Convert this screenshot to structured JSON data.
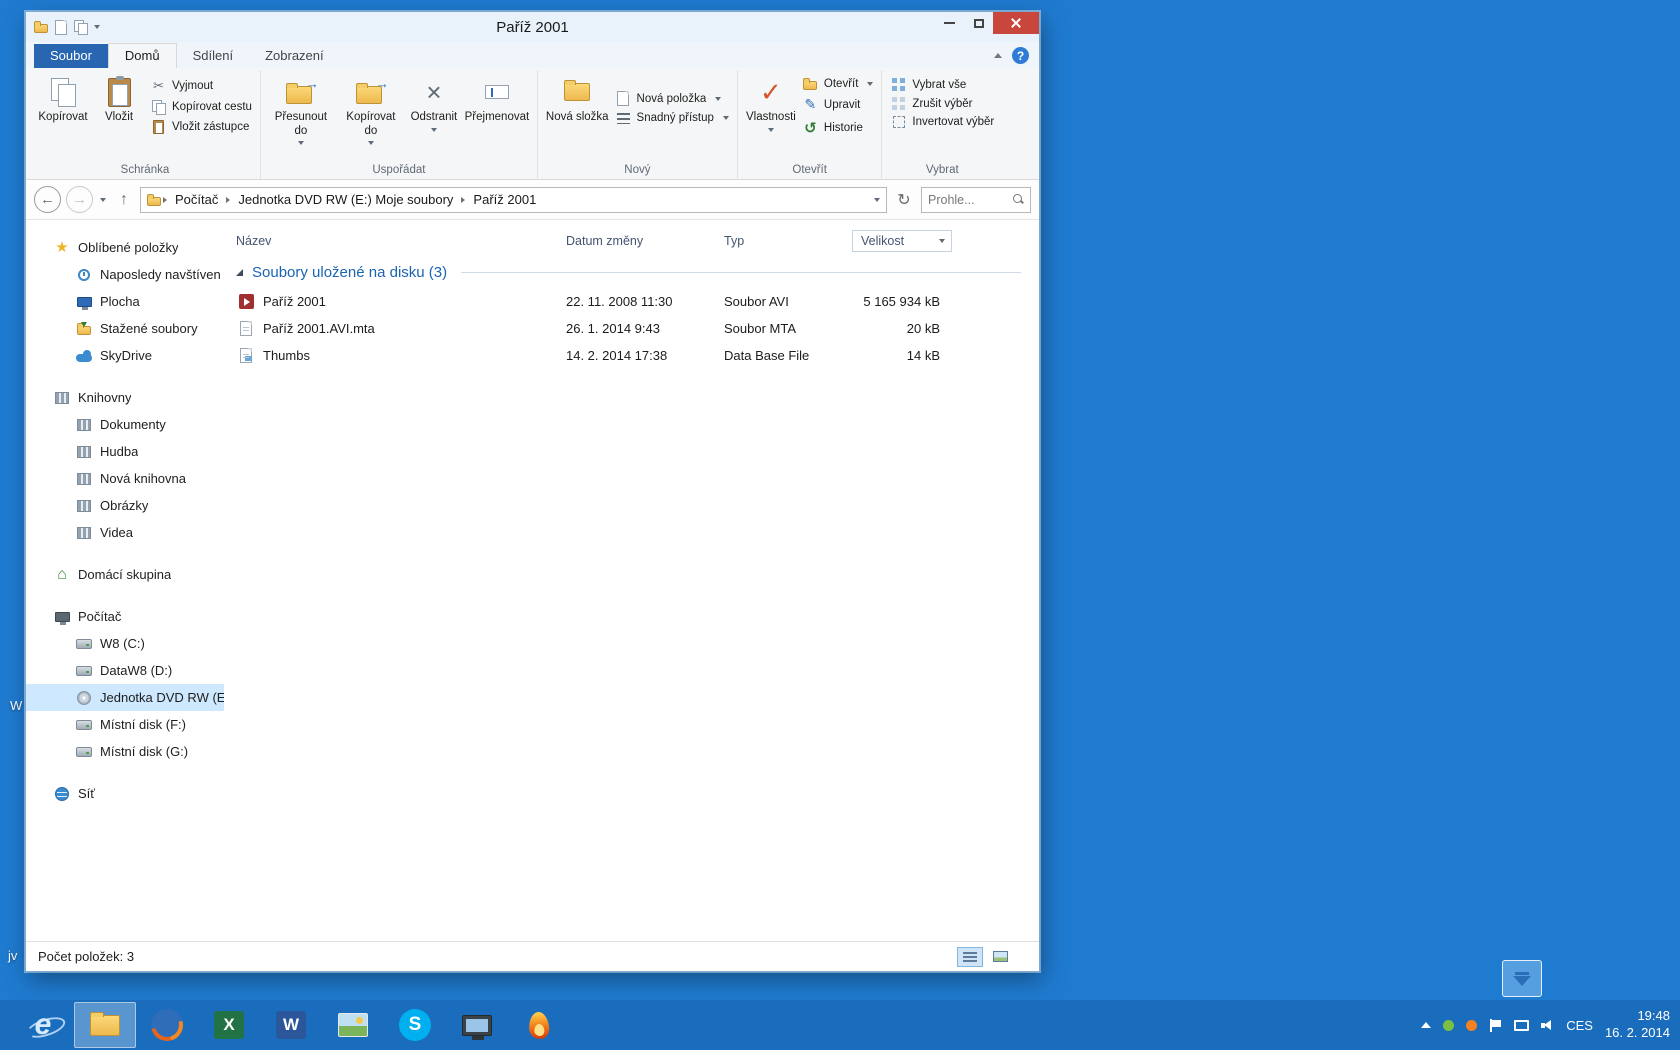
{
  "colors": {
    "desktop": "#1f7bd0",
    "taskbar": "#1a6cbd",
    "window_chrome": "#e9f2fb",
    "close_red": "#c8463c",
    "file_tab_blue": "#2866b2",
    "selection_blue": "#cde8ff",
    "group_header_blue": "#1a64b0"
  },
  "icons": {
    "help": "?",
    "star": "★",
    "back": "←",
    "forward": "→",
    "up": "↑",
    "refresh": "↻",
    "scissors": "✂",
    "delete": "×",
    "check": "✓",
    "pencil": "✎",
    "history": "↺",
    "house": "⌂",
    "arrow_small": "→",
    "ie_letter": "e",
    "excel_letter": "X",
    "word_letter": "W",
    "skype_letter": "S"
  },
  "desktop": {
    "fragments": [
      {
        "text": "W"
      },
      {
        "text": "jv"
      }
    ]
  },
  "window": {
    "title": "Paříž 2001"
  },
  "ribbon": {
    "tabs": [
      {
        "label": "Soubor"
      },
      {
        "label": "Domů"
      },
      {
        "label": "Sdílení"
      },
      {
        "label": "Zobrazení"
      }
    ],
    "groups": [
      {
        "label": "Schránka",
        "big": [
          {
            "label": "Kopírovat"
          },
          {
            "label": "Vložit"
          }
        ],
        "small": [
          {
            "label": "Vyjmout"
          },
          {
            "label": "Kopírovat cestu"
          },
          {
            "label": "Vložit zástupce"
          }
        ]
      },
      {
        "label": "Uspořádat",
        "big": [
          {
            "label": "Přesunout do"
          },
          {
            "label": "Kopírovat do"
          },
          {
            "label": "Odstranit"
          },
          {
            "label": "Přejmenovat"
          }
        ]
      },
      {
        "label": "Nový",
        "big": [
          {
            "label": "Nová složka"
          }
        ],
        "small": [
          {
            "label": "Nová položka"
          },
          {
            "label": "Snadný přístup"
          }
        ]
      },
      {
        "label": "Otevřít",
        "big": [
          {
            "label": "Vlastnosti"
          }
        ],
        "small": [
          {
            "label": "Otevřít"
          },
          {
            "label": "Upravit"
          },
          {
            "label": "Historie"
          }
        ]
      },
      {
        "label": "Vybrat",
        "small": [
          {
            "label": "Vybrat vše"
          },
          {
            "label": "Zrušit výběr"
          },
          {
            "label": "Invertovat výběr"
          }
        ]
      }
    ]
  },
  "address": {
    "crumbs": [
      {
        "label": "Počítač"
      },
      {
        "label": "Jednotka DVD RW (E:) Moje soubory"
      },
      {
        "label": "Paříž 2001"
      }
    ],
    "search_value": "Prohle..."
  },
  "sidebar": {
    "sections": [
      {
        "label": "Oblíbené položky",
        "items": [
          {
            "label": "Naposledy navštíven"
          },
          {
            "label": "Plocha"
          },
          {
            "label": "Stažené soubory"
          },
          {
            "label": "SkyDrive"
          }
        ]
      },
      {
        "label": "Knihovny",
        "items": [
          {
            "label": "Dokumenty"
          },
          {
            "label": "Hudba"
          },
          {
            "label": "Nová knihovna"
          },
          {
            "label": "Obrázky"
          },
          {
            "label": "Videa"
          }
        ]
      },
      {
        "label": "Domácí skupina",
        "items": []
      },
      {
        "label": "Počítač",
        "items": [
          {
            "label": "W8 (C:)"
          },
          {
            "label": "DataW8 (D:)"
          },
          {
            "label": "Jednotka DVD RW (E"
          },
          {
            "label": "Místní disk (F:)"
          },
          {
            "label": "Místní disk (G:)"
          }
        ]
      },
      {
        "label": "Síť",
        "items": []
      }
    ]
  },
  "filelist": {
    "columns": [
      {
        "label": "Název"
      },
      {
        "label": "Datum změny"
      },
      {
        "label": "Typ"
      },
      {
        "label": "Velikost"
      }
    ],
    "group_label": "Soubory uložené na disku (3)",
    "rows": [
      {
        "name": "Paříž 2001",
        "date": "22. 11. 2008 11:30",
        "type": "Soubor AVI",
        "size": "5 165 934 kB"
      },
      {
        "name": "Paříž 2001.AVI.mta",
        "date": "26. 1. 2014 9:43",
        "type": "Soubor MTA",
        "size": "20 kB"
      },
      {
        "name": "Thumbs",
        "date": "14. 2. 2014 17:38",
        "type": "Data Base File",
        "size": "14 kB"
      }
    ]
  },
  "statusbar": {
    "count": "Počet položek: 3"
  },
  "taskbar": {
    "tray": {
      "language": "CES",
      "time": "19:48",
      "date": "16. 2. 2014"
    }
  }
}
